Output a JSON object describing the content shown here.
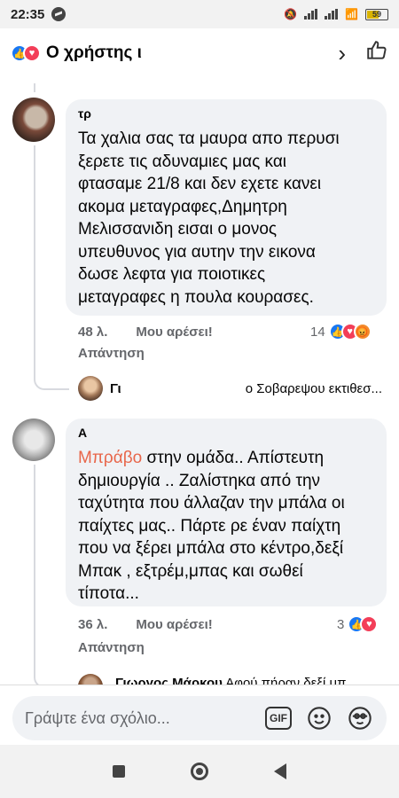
{
  "status_bar": {
    "time": "22:35",
    "battery": "59"
  },
  "header": {
    "title": "Ο χρήστης ι"
  },
  "comments": [
    {
      "author": "τρ",
      "text": "Τα χαλια σας τα μαυρα απο περυσι\nξερετε τις αδυναμιες μας και\nφτασαμε 21/8 και δεν εχετε κανει\nακομα μεταγραφες,Δημητρη\nΜελισσανιδη εισαι ο μονος\nυπευθυνος για αυτην την εικονα\nδωσε λεφτα για ποιοτικες\nμεταγραφες η πουλα κουρασες.",
      "time": "48 λ.",
      "like": "Μου αρέσει!",
      "reply": "Απάντηση",
      "reactions_count": "14",
      "reply_preview": {
        "name": "Γι",
        "text": "ο Σοβαρεψου εκτιθεσ..."
      }
    },
    {
      "author": "Α",
      "highlight": "Μπράβο",
      "text": " στην ομάδα.. Απίστευτη\nδημιουργία .. Ζαλίστηκα από την\nταχύτητα που άλλαζαν την μπάλα οι\nπαίχτες μας.. Πάρτε ρε έναν παίχτη\nπου να ξέρει μπάλα στο κέντρο,δεξί\nΜπακ , εξτρέμ,μπας και σωθεί\nτίποτα...",
      "time": "36 λ.",
      "like": "Μου αρέσει!",
      "reply": "Απάντηση",
      "reactions_count": "3",
      "reply_preview": {
        "name": "Γιωργος Μάρκου",
        "text": " Αφού πήραν δεξί μπ"
      }
    }
  ],
  "composer": {
    "placeholder": "Γράψτε ένα σχόλιο...",
    "gif": "GIF"
  }
}
